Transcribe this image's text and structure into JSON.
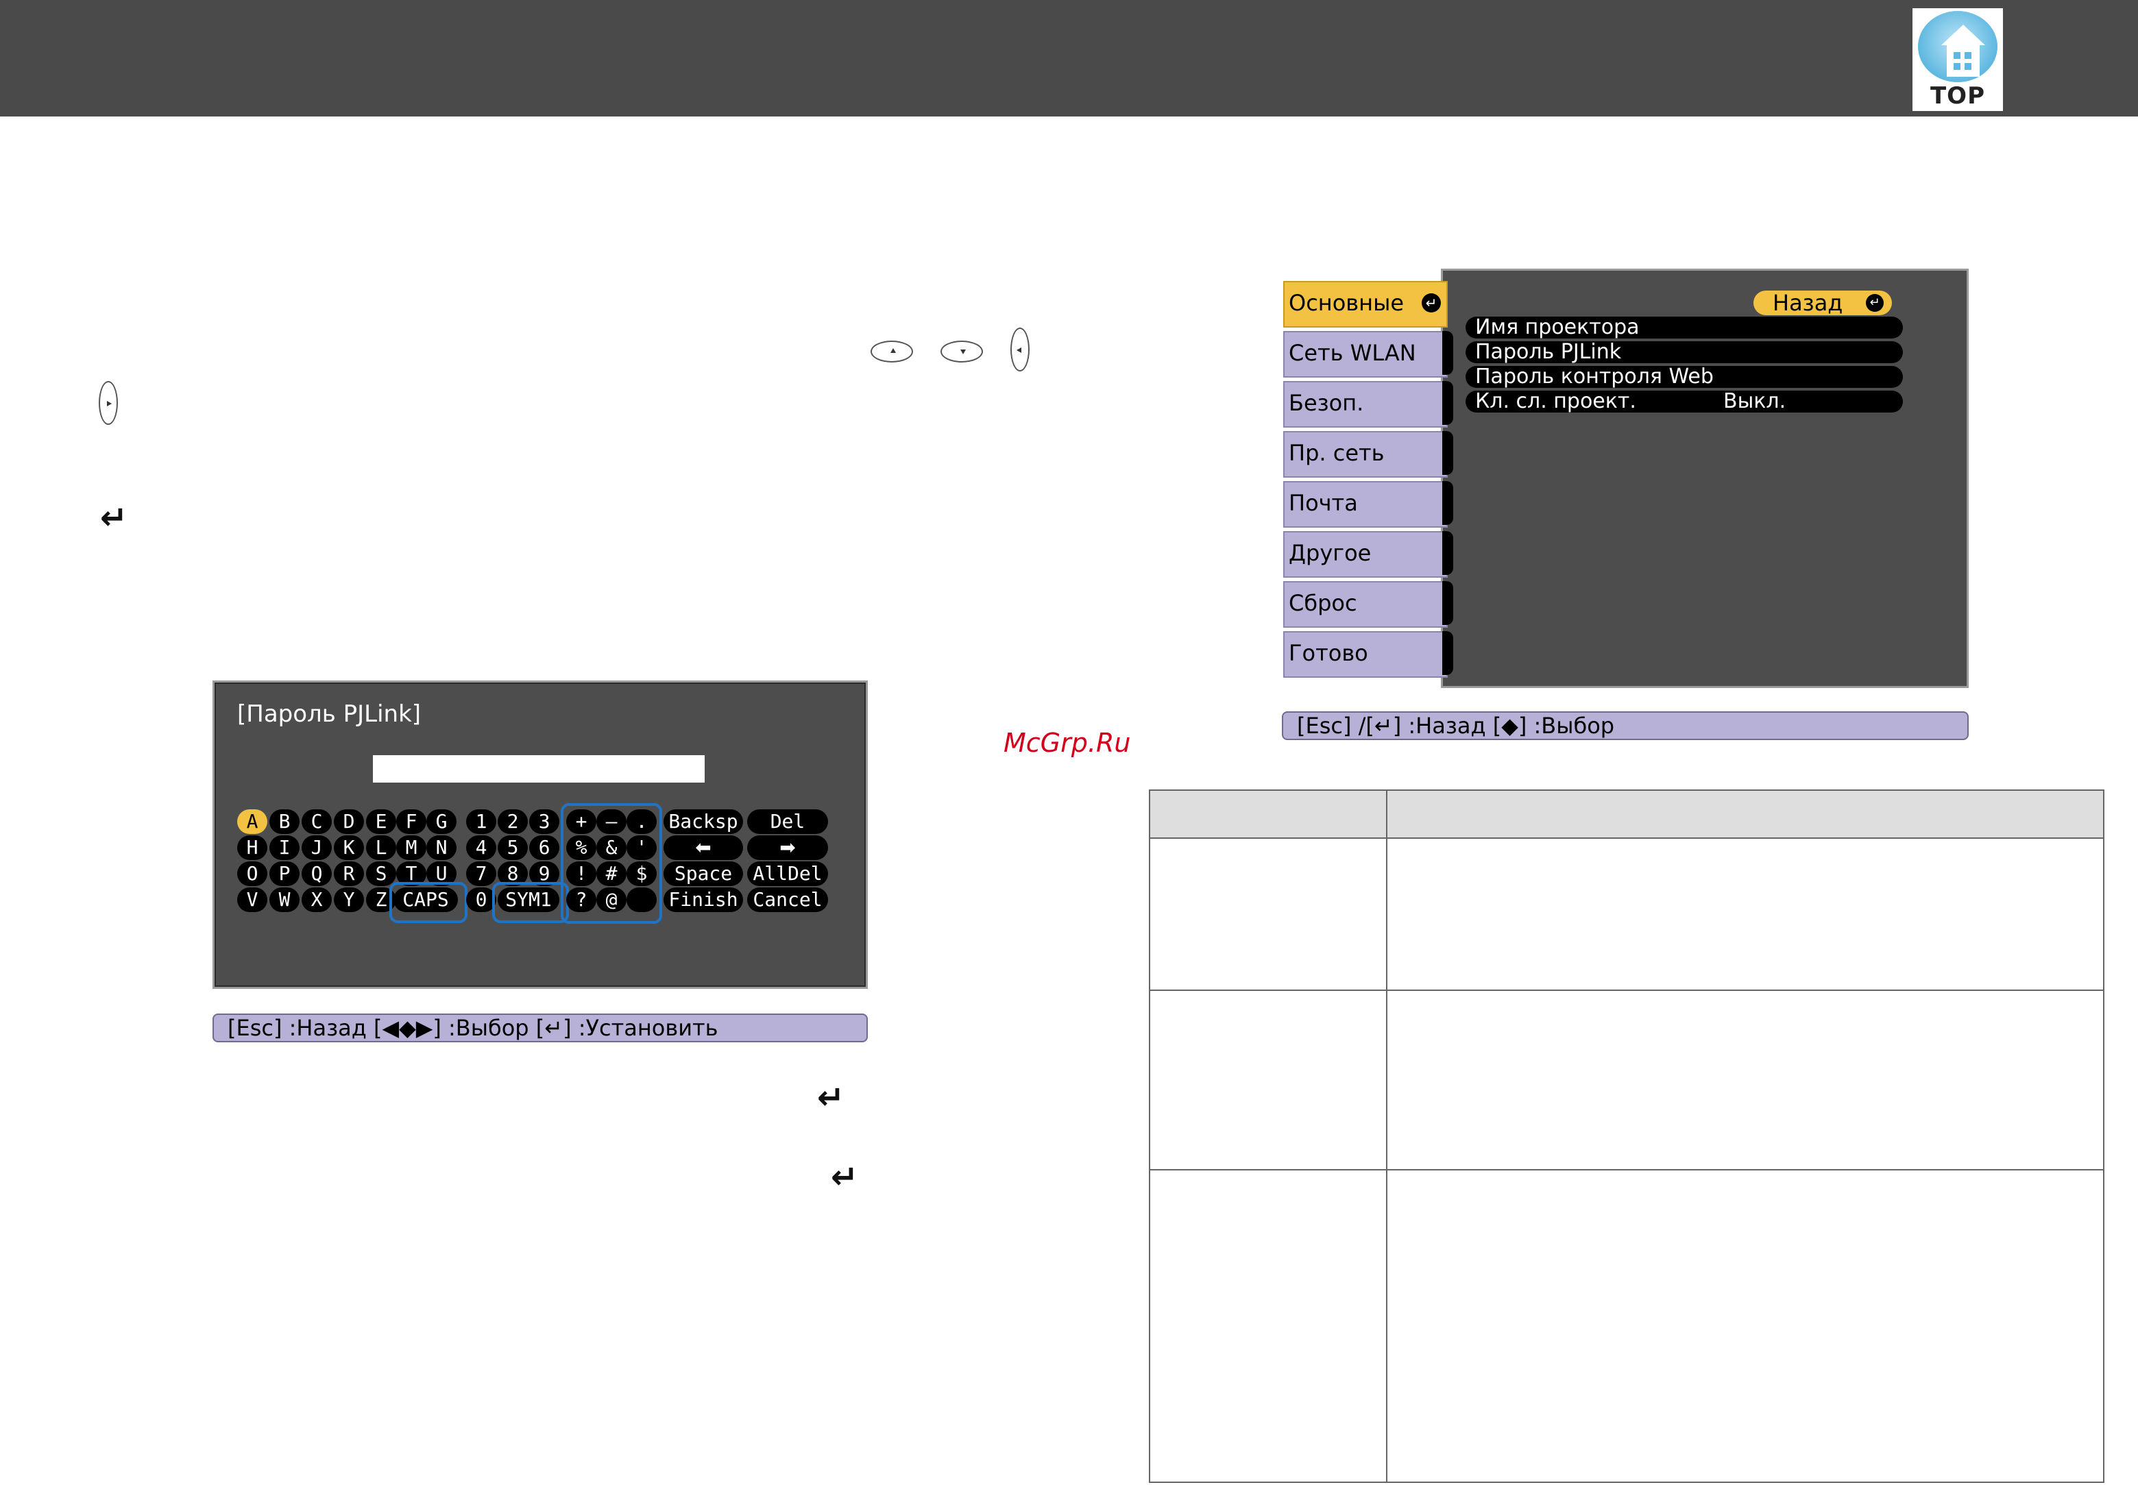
{
  "header": {
    "logo_text": "TOP"
  },
  "pw_screen": {
    "title": "[Пароль PJLink]",
    "input_value": "",
    "keys": {
      "letters_row1": [
        "A",
        "B",
        "C",
        "D",
        "E",
        "F",
        "G"
      ],
      "letters_row2": [
        "H",
        "I",
        "J",
        "K",
        "L",
        "M",
        "N"
      ],
      "letters_row3": [
        "O",
        "P",
        "Q",
        "R",
        "S",
        "T",
        "U"
      ],
      "letters_row4": [
        "V",
        "W",
        "X",
        "Y",
        "Z"
      ],
      "caps": "CAPS",
      "digits_row1": [
        "1",
        "2",
        "3"
      ],
      "digits_row2": [
        "4",
        "5",
        "6"
      ],
      "digits_row3": [
        "7",
        "8",
        "9"
      ],
      "digit_zero": "0",
      "sym": "SYM1",
      "symbols_row1": [
        "+",
        "–",
        "."
      ],
      "symbols_row2": [
        "%",
        "&",
        "'"
      ],
      "symbols_row3": [
        "!",
        "#",
        "$"
      ],
      "symbols_row4": [
        "?",
        "@",
        ""
      ],
      "backsp": "Backsp",
      "del": "Del",
      "left_arrow": "⬅",
      "right_arrow": "➡",
      "space": "Space",
      "alldel": "AllDel",
      "finish": "Finish",
      "cancel": "Cancel"
    },
    "selected_key": "A",
    "status_bar": "[Esc] :Назад  [◀◆▶] :Выбор  [↵] :Установить"
  },
  "network_menu": {
    "tabs": [
      "Основные",
      "Сеть WLAN",
      "Безоп.",
      "Пр. сеть",
      "Почта",
      "Другое",
      "Сброс",
      "Готово"
    ],
    "active_tab": "Основные",
    "back_button": "Назад",
    "items": [
      {
        "label": "Имя проектора",
        "value": ""
      },
      {
        "label": "Пароль PJLink",
        "value": ""
      },
      {
        "label": "Пароль контроля Web",
        "value": ""
      },
      {
        "label": "Кл. сл. проект.",
        "value": "Выкл."
      }
    ],
    "status_bar": "[Esc] /[↵] :Назад  [◆] :Выбор"
  },
  "watermark": "McGrp.Ru",
  "table": {
    "headers": [
      "",
      ""
    ],
    "rows": [
      [
        "",
        ""
      ],
      [
        "",
        ""
      ],
      [
        "",
        ""
      ]
    ]
  }
}
